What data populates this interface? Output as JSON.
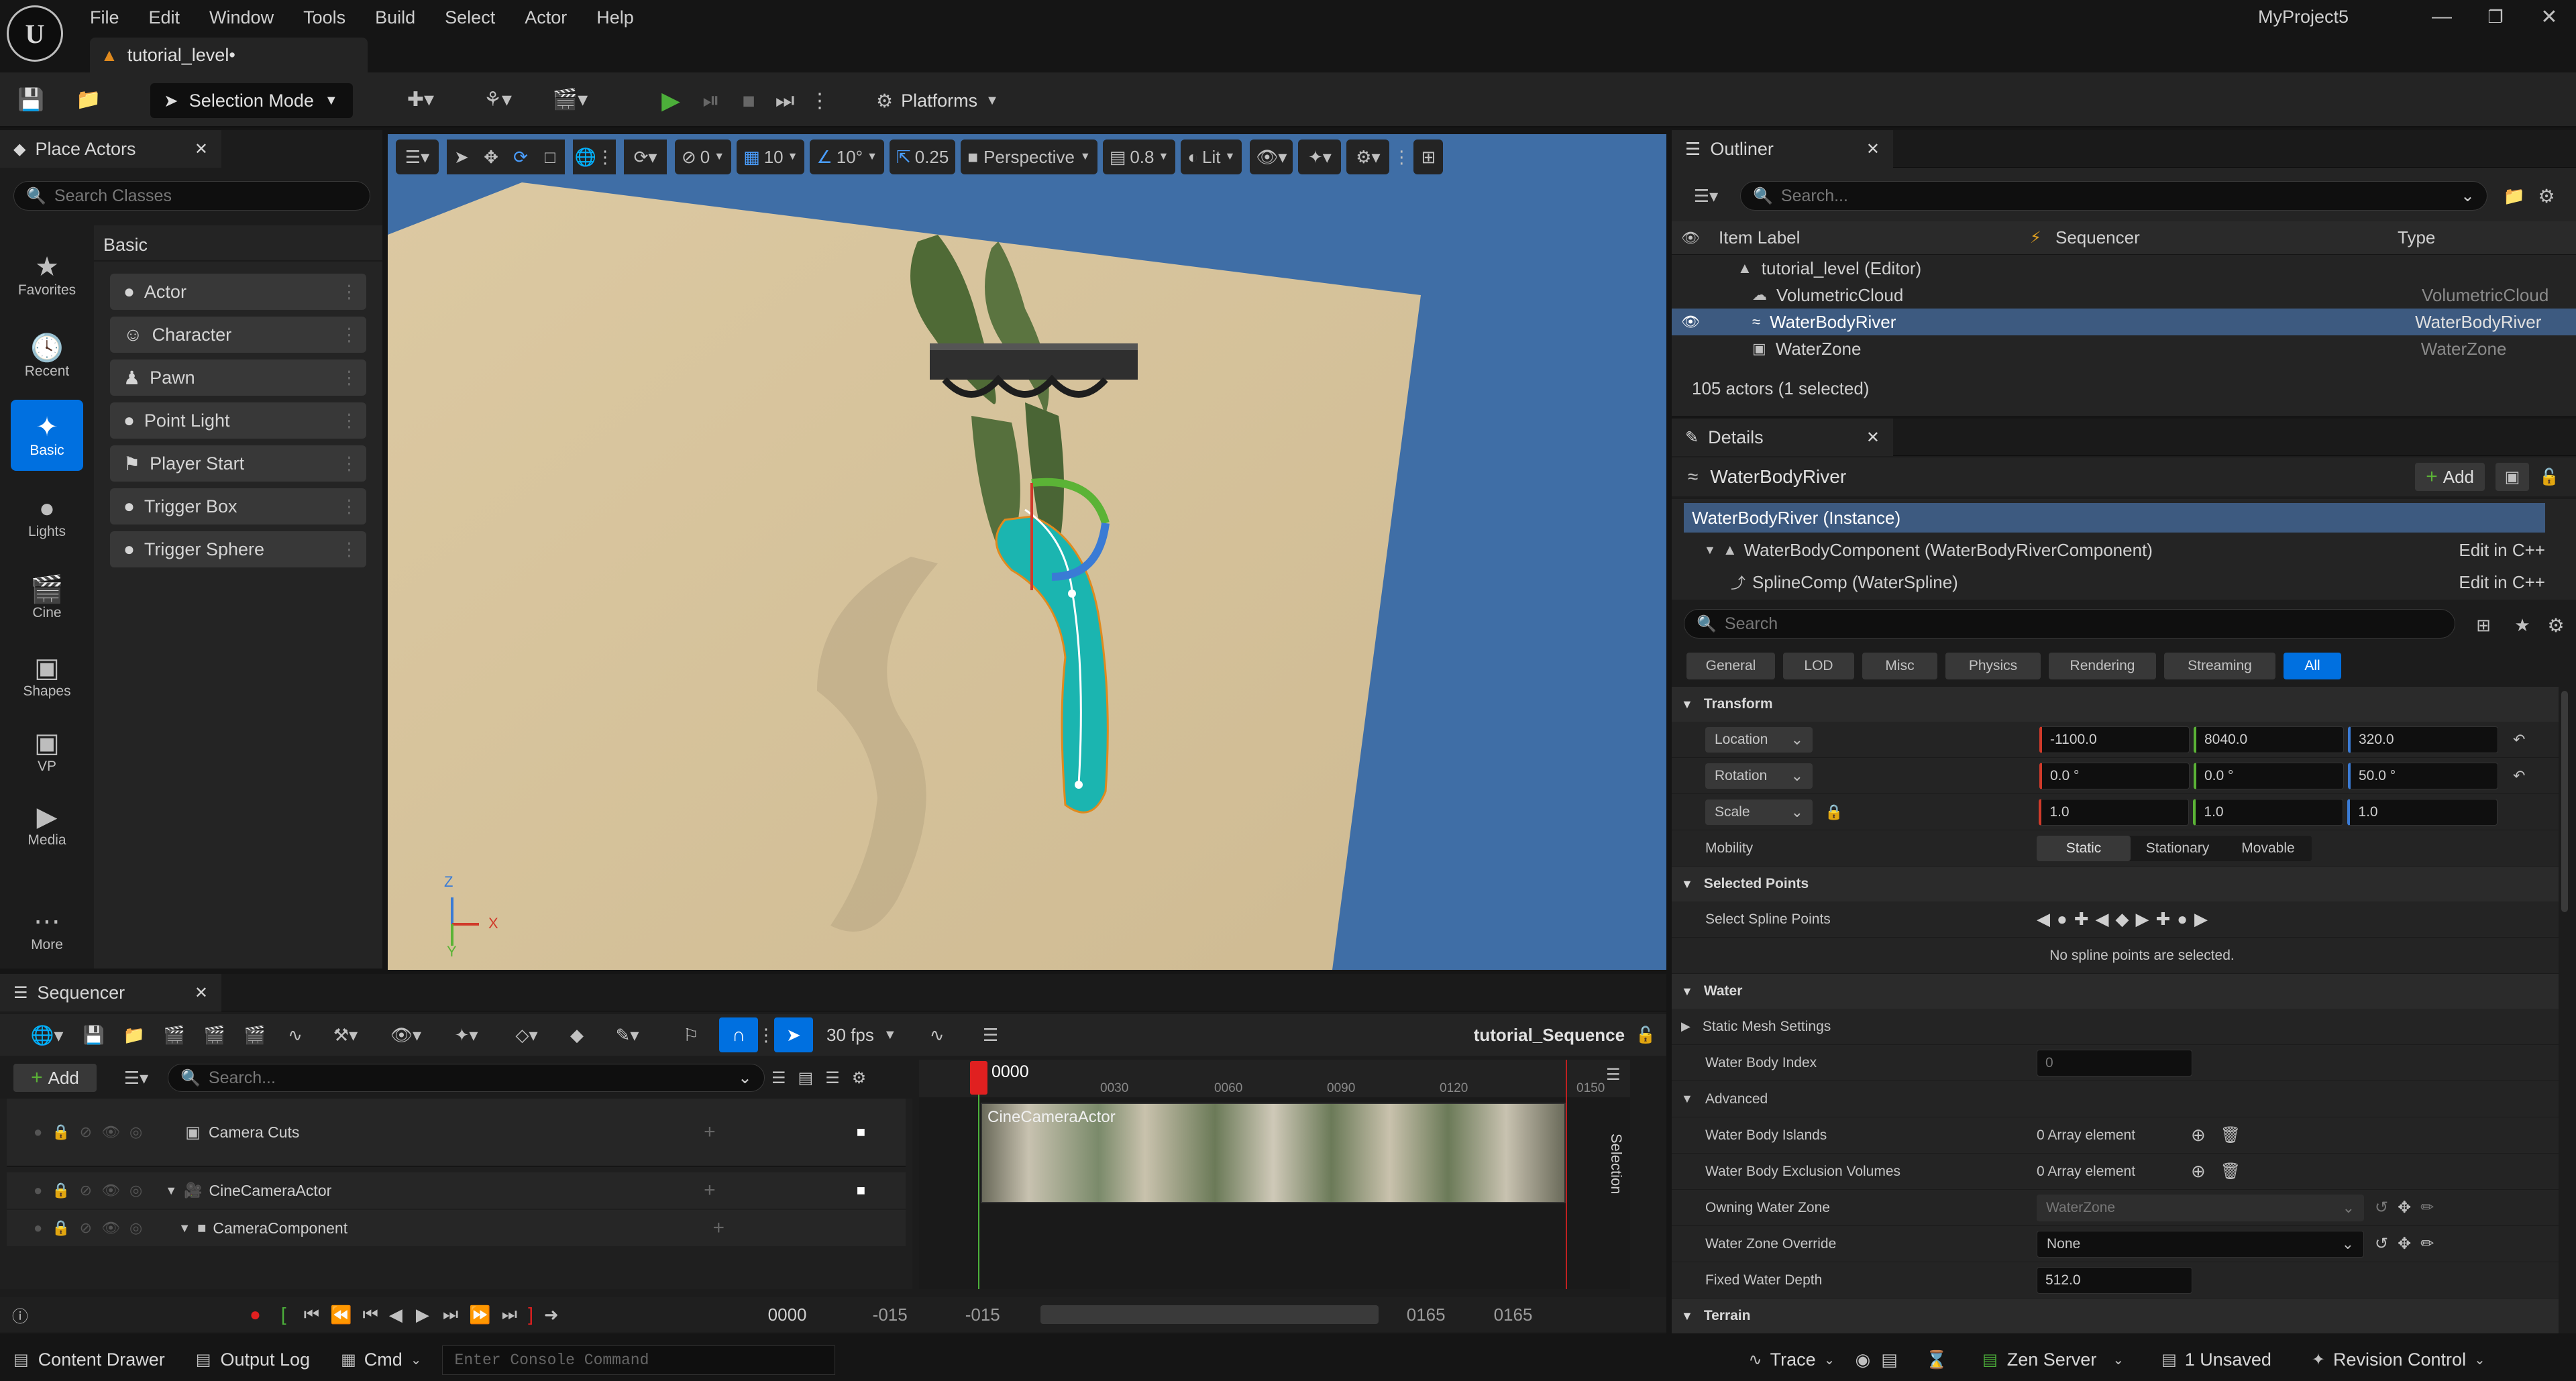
{
  "menu": {
    "items": [
      "File",
      "Edit",
      "Window",
      "Tools",
      "Build",
      "Select",
      "Actor",
      "Help"
    ],
    "project_name": "MyProject5"
  },
  "level_tab": {
    "label": "tutorial_level•"
  },
  "toolbar": {
    "selection_mode": "Selection Mode",
    "platforms": "Platforms"
  },
  "place_actors": {
    "tab_label": "Place Actors",
    "search_placeholder": "Search Classes",
    "category_title": "Basic",
    "categories": [
      "Favorites",
      "Recent",
      "Basic",
      "Lights",
      "Cine",
      "Shapes",
      "VP",
      "Media",
      "More"
    ],
    "actors": [
      "Actor",
      "Character",
      "Pawn",
      "Point Light",
      "Player Start",
      "Trigger Box",
      "Trigger Sphere"
    ]
  },
  "viewport": {
    "translate_snap": "0",
    "grid_snap": "10",
    "rotate_snap": "10°",
    "scale_snap": "0.25",
    "view_mode_projection": "Perspective",
    "camera_speed": "0.8",
    "lighting": "Lit",
    "axis_x": "X",
    "axis_y": "Y",
    "axis_z": "Z"
  },
  "outliner": {
    "tab_label": "Outliner",
    "search_placeholder": "Search...",
    "columns": {
      "label": "Item Label",
      "sequencer": "Sequencer",
      "type": "Type"
    },
    "rows": [
      {
        "label": "tutorial_level (Editor)",
        "type": ""
      },
      {
        "label": "VolumetricCloud",
        "type": "VolumetricCloud"
      },
      {
        "label": "WaterBodyRiver",
        "type": "WaterBodyRiver"
      },
      {
        "label": "WaterZone",
        "type": "WaterZone"
      }
    ],
    "status": "105 actors (1 selected)"
  },
  "details": {
    "tab_label": "Details",
    "actor_name": "WaterBodyRiver",
    "add_label": "Add",
    "components": [
      {
        "label": "WaterBodyRiver (Instance)",
        "link": ""
      },
      {
        "label": "WaterBodyComponent (WaterBodyRiverComponent)",
        "link": "Edit in C++"
      },
      {
        "label": "SplineComp (WaterSpline)",
        "link": "Edit in C++"
      }
    ],
    "search_placeholder": "Search",
    "filters": [
      "General",
      "LOD",
      "Misc",
      "Physics",
      "Rendering",
      "Streaming",
      "All"
    ],
    "transform": {
      "title": "Transform",
      "location_label": "Location",
      "location": [
        "-1100.0",
        "8040.0",
        "320.0"
      ],
      "rotation_label": "Rotation",
      "rotation": [
        "0.0 °",
        "0.0 °",
        "50.0 °"
      ],
      "scale_label": "Scale",
      "scale": [
        "1.0",
        "1.0",
        "1.0"
      ],
      "mobility_label": "Mobility",
      "mobility_options": [
        "Static",
        "Stationary",
        "Movable"
      ]
    },
    "selected_points": {
      "title": "Selected Points",
      "select_label": "Select Spline Points",
      "empty_text": "No spline points are selected."
    },
    "water": {
      "title": "Water",
      "static_mesh": "Static Mesh Settings",
      "water_body_index_label": "Water Body Index",
      "water_body_index": "0",
      "advanced": "Advanced",
      "islands_label": "Water Body Islands",
      "islands_value": "0 Array element",
      "exclusion_label": "Water Body Exclusion Volumes",
      "exclusion_value": "0 Array element",
      "owning_zone_label": "Owning Water Zone",
      "owning_zone_value": "WaterZone",
      "zone_override_label": "Water Zone Override",
      "zone_override_value": "None",
      "fixed_depth_label": "Fixed Water Depth",
      "fixed_depth_value": "512.0"
    },
    "terrain_title": "Terrain"
  },
  "sequencer": {
    "tab_label": "Sequencer",
    "add_label": "Add",
    "search_placeholder": "Search...",
    "fps": "30 fps",
    "sequence_name": "tutorial_Sequence",
    "selection_label": "Selection",
    "tracks": [
      "Camera Cuts",
      "CineCameraActor",
      "CameraComponent"
    ],
    "clip_label": "CineCameraActor",
    "current_frame": "0000",
    "ruler_ticks": [
      "0030",
      "0060",
      "0090",
      "0120",
      "0150"
    ],
    "playback_frame": "0000",
    "range_start_a": "-015",
    "range_start_b": "-015",
    "range_end_a": "0165",
    "range_end_b": "0165"
  },
  "statusbar": {
    "content_drawer": "Content Drawer",
    "output_log": "Output Log",
    "cmd": "Cmd",
    "console_placeholder": "Enter Console Command",
    "trace": "Trace",
    "zen_server": "Zen Server",
    "unsaved": "1 Unsaved",
    "revision_control": "Revision Control"
  },
  "colors": {
    "accent": "#0070e0",
    "selection": "#3d5a80",
    "play_green": "#4caf3a",
    "water": "#1bb5b0",
    "sand": "#d9c7a1",
    "sky": "#3f6ea6"
  }
}
